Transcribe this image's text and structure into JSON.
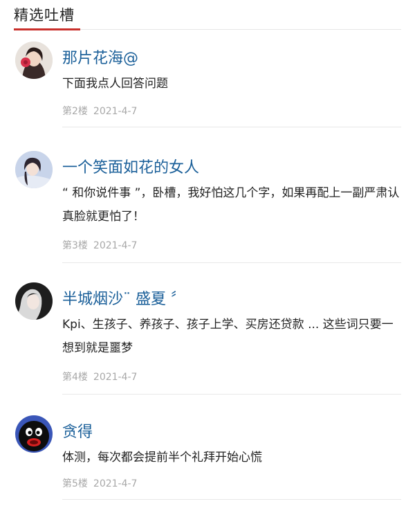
{
  "section": {
    "title": "精选吐槽",
    "accent_color": "#c9302c"
  },
  "comments": [
    {
      "username": "那片花海@",
      "avatar_icon": "avatar-woman-with-flower",
      "content": "下面我点人回答问题",
      "floor": "第2楼",
      "date": "2021-4-7"
    },
    {
      "username": "一个笑面如花的女人",
      "avatar_icon": "avatar-woman-portrait",
      "content": "“ 和你说件事 ”，卧槽，我好怕这几个字，如果再配上一副严肃认真脸就更怕了！",
      "floor": "第3楼",
      "date": "2021-4-7"
    },
    {
      "username": "半城烟沙¨ 盛夏 〞",
      "avatar_icon": "avatar-woman-dark-hair",
      "content": "Kpi、生孩子、养孩子、孩子上学、买房还贷款 ... 这些词只要一想到就是噩梦",
      "floor": "第4楼",
      "date": "2021-4-7"
    },
    {
      "username": "贪得",
      "avatar_icon": "avatar-black-cartoon-face",
      "content": "体测，每次都会提前半个礼拜开始心慌",
      "floor": "第5楼",
      "date": "2021-4-7"
    }
  ],
  "colors": {
    "username": "#1a5f99",
    "text": "#222222",
    "meta": "#a8a8a8"
  }
}
